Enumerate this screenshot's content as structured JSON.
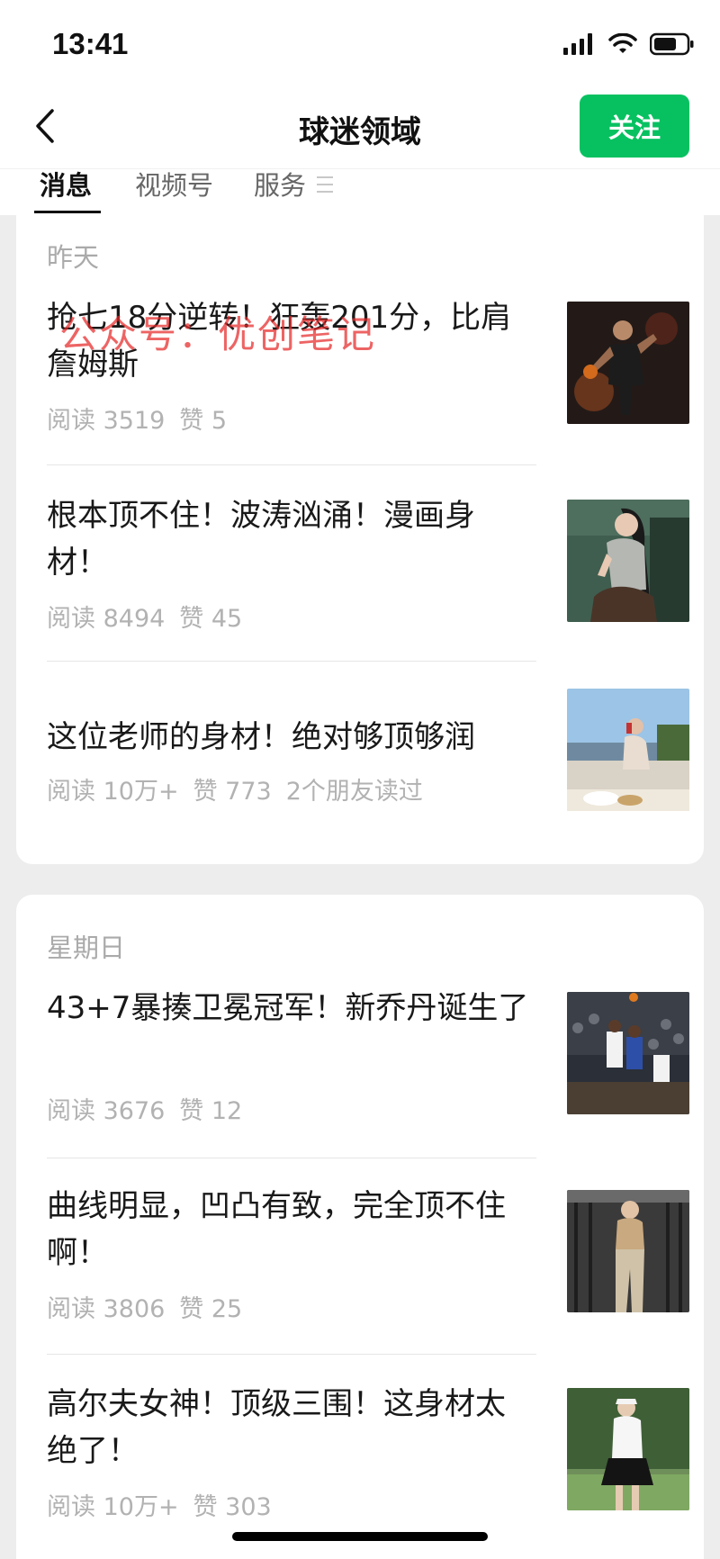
{
  "status_bar": {
    "time": "13:41"
  },
  "nav": {
    "title": "球迷领域",
    "follow_label": "关注"
  },
  "tabs": [
    {
      "label": "消息"
    },
    {
      "label": "视频号"
    },
    {
      "label": "服务"
    }
  ],
  "watermark": "公众号：优创笔记",
  "groups": [
    {
      "date": "昨天",
      "articles": [
        {
          "title": "抢七18分逆转！狂轰201分，比肩詹姆斯",
          "reads": "阅读 3519",
          "likes": "赞 5",
          "extra": "",
          "thumb_icon": "basketball-player-photo"
        },
        {
          "title": "根本顶不住！波涛汹涌！漫画身材！",
          "reads": "阅读 8494",
          "likes": "赞 45",
          "extra": "",
          "thumb_icon": "woman-photo"
        },
        {
          "title": "这位老师的身材！绝对够顶够润",
          "reads": "阅读 10万+",
          "likes": "赞 773",
          "extra": "2个朋友读过",
          "thumb_icon": "poolside-photo"
        }
      ]
    },
    {
      "date": "星期日",
      "articles": [
        {
          "title": "43+7暴揍卫冕冠军！新乔丹诞生了",
          "reads": "阅读 3676",
          "likes": "赞 12",
          "extra": "",
          "thumb_icon": "basketball-game-photo"
        },
        {
          "title": "曲线明显，凹凸有致，完全顶不住啊！",
          "reads": "阅读 3806",
          "likes": "赞 25",
          "extra": "",
          "thumb_icon": "gym-photo"
        },
        {
          "title": "高尔夫女神！顶级三围！这身材太绝了！",
          "reads": "阅读 10万+",
          "likes": "赞 303",
          "extra": "",
          "thumb_icon": "golf-photo"
        }
      ]
    }
  ],
  "colors": {
    "accent": "#07c160",
    "background": "#ededed",
    "meta_text": "#b2b2b2"
  }
}
